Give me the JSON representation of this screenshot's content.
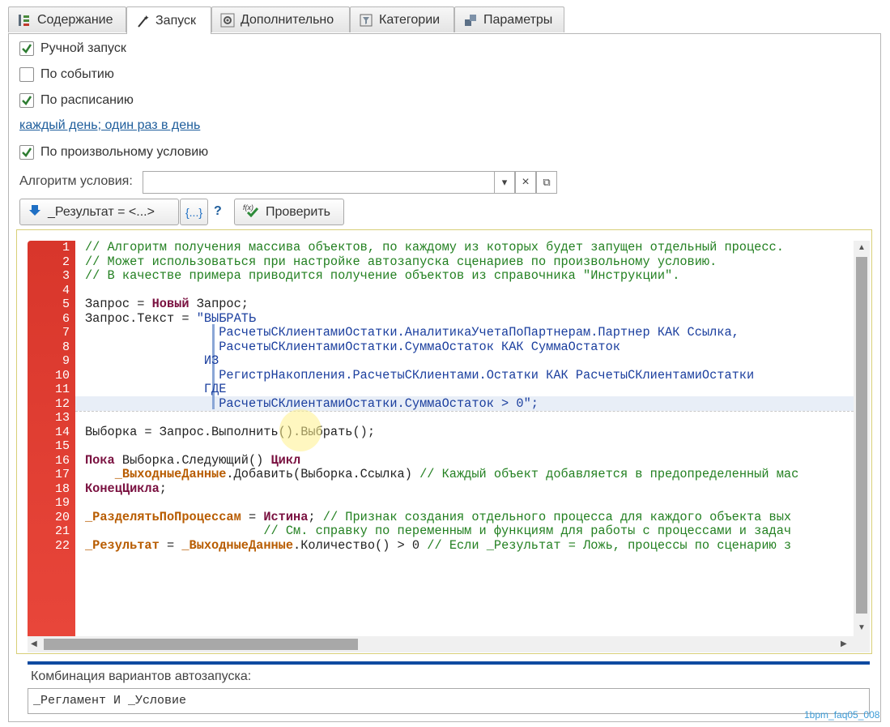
{
  "tabs": [
    {
      "label": "Содержание",
      "icon": "tree-structure-icon",
      "active": false
    },
    {
      "label": "Запуск",
      "icon": "magic-wand-icon",
      "active": true
    },
    {
      "label": "Дополнительно",
      "icon": "gear-icon",
      "active": false
    },
    {
      "label": "Категории",
      "icon": "category-filter-icon",
      "active": false
    },
    {
      "label": "Параметры",
      "icon": "parameters-icon",
      "active": false
    }
  ],
  "launch": {
    "manual": {
      "label": "Ручной запуск",
      "checked": true
    },
    "on_event": {
      "label": "По событию",
      "checked": false
    },
    "on_schedule": {
      "label": "По расписанию",
      "checked": true
    },
    "schedule_link": "каждый день; один раз в день",
    "on_condition": {
      "label": "По произвольному условию",
      "checked": true
    }
  },
  "algorithm": {
    "label": "Алгоритм условия:",
    "value": "",
    "dropdown_symbol": "▾",
    "clear_symbol": "×",
    "open_symbol": "⧉"
  },
  "toolbar": {
    "result_button": "_Результат = <...>",
    "braces_button": "{...}",
    "help": "?",
    "check_button": "Проверить"
  },
  "editor": {
    "line_numbers": [
      "1",
      "2",
      "3",
      "4",
      "5",
      "6",
      "7",
      "8",
      "9",
      "10",
      "11",
      "12",
      "13",
      "14",
      "15",
      "16",
      "17",
      "18",
      "19",
      "20",
      "21",
      "22"
    ]
  },
  "combination": {
    "label": "Комбинация вариантов автозапуска:",
    "value": "_Регламент И _Условие"
  },
  "watermark": "1bpm_faq05_008",
  "colors": {
    "gutter": "#e0402f",
    "comment": "#238021",
    "keyword": "#7a1140",
    "string": "#1a3e9e",
    "variable": "#b85c00",
    "separator": "#0e4aa0"
  }
}
